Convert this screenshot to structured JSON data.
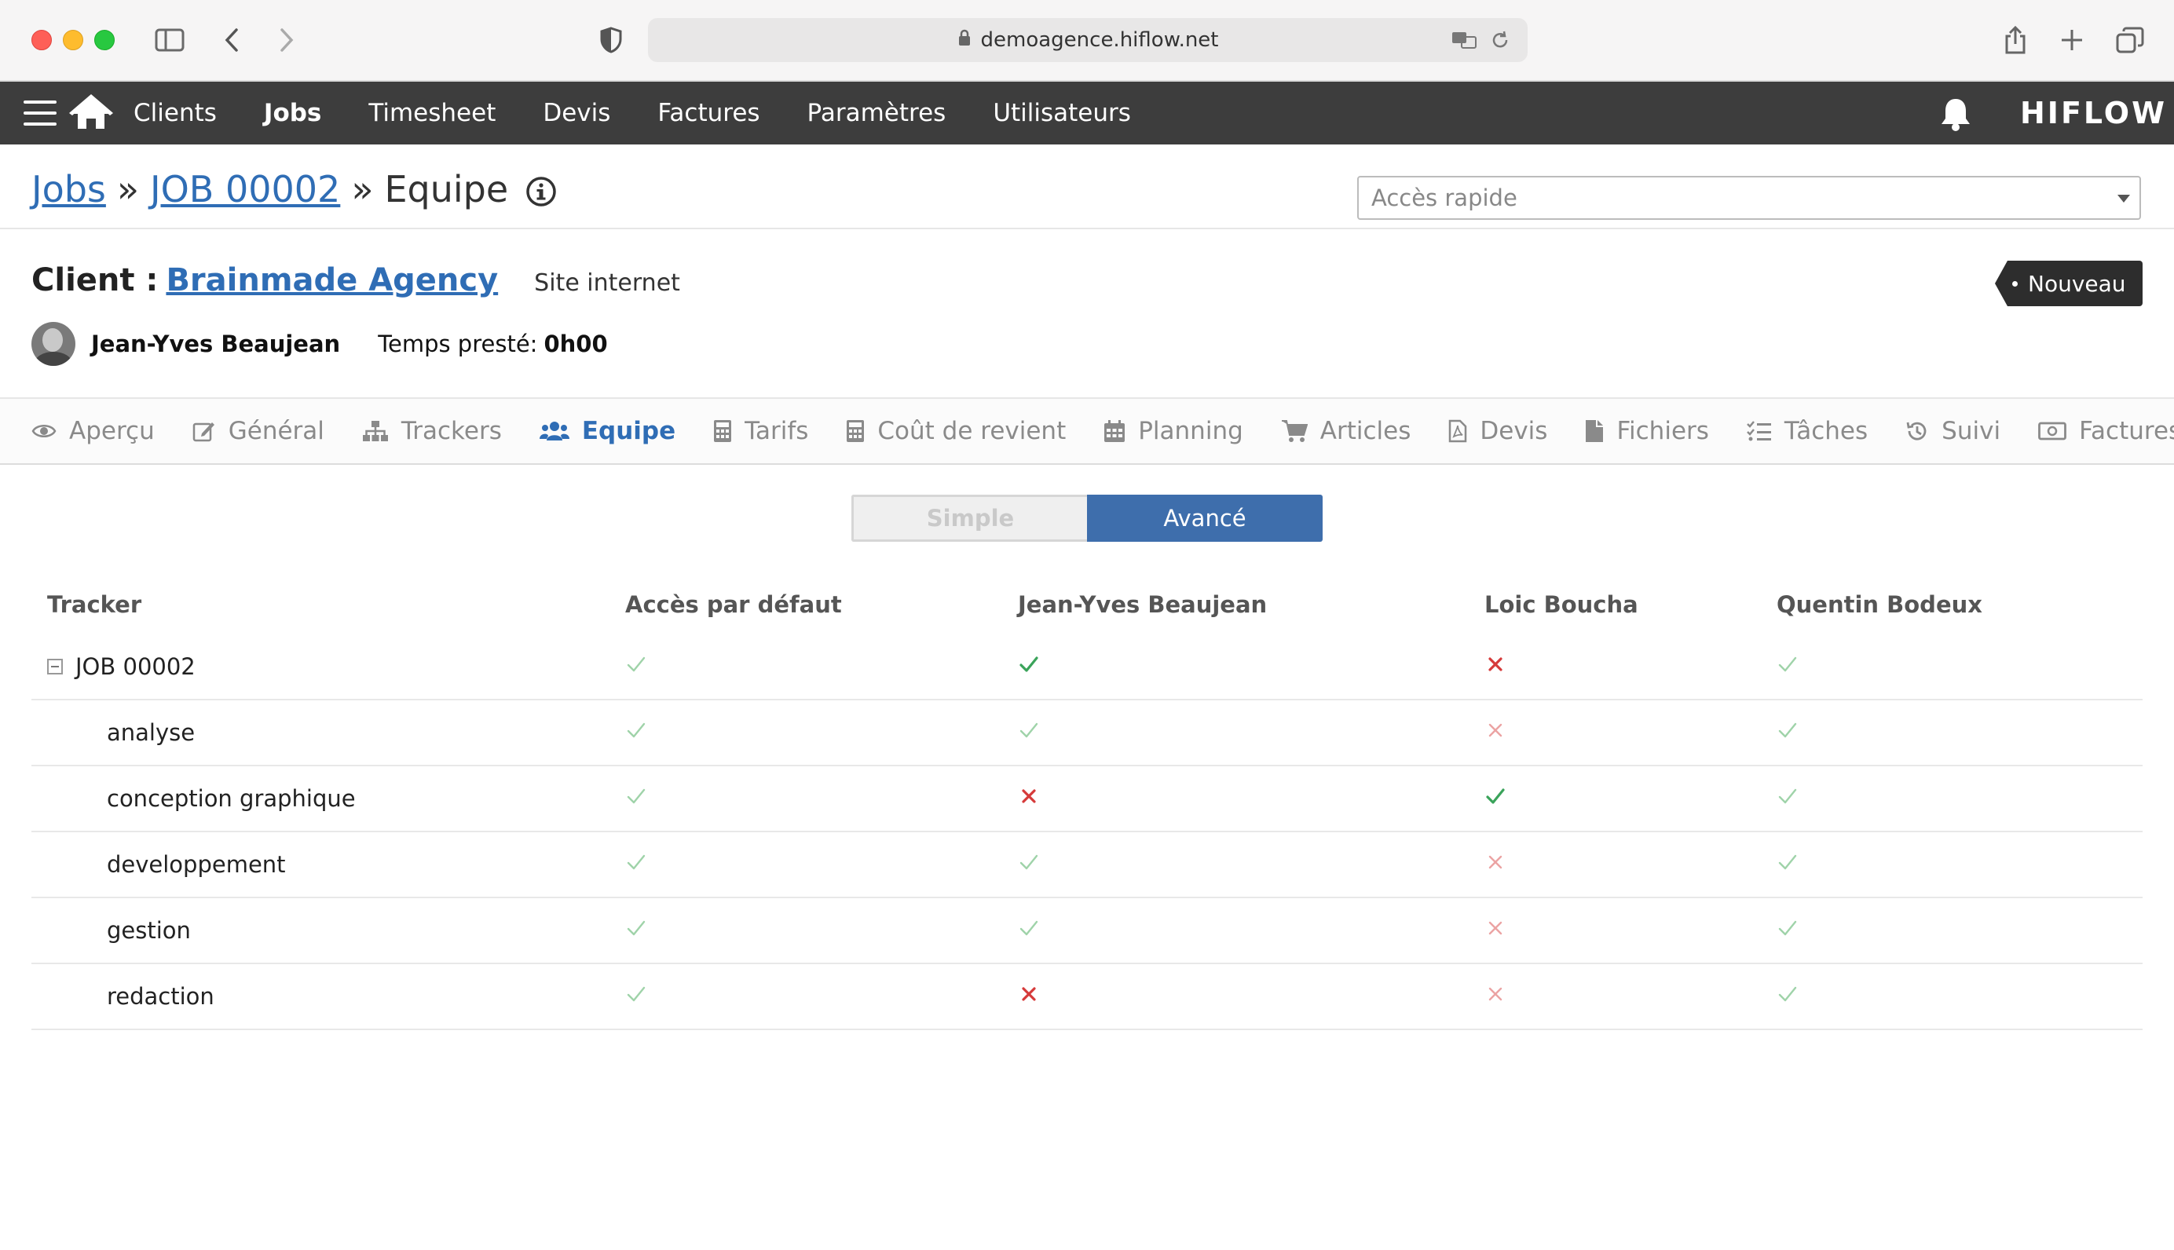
{
  "browser": {
    "url": "demoagence.hiflow.net"
  },
  "nav": {
    "items": [
      "Clients",
      "Jobs",
      "Timesheet",
      "Devis",
      "Factures",
      "Paramètres",
      "Utilisateurs"
    ],
    "active": "Jobs",
    "logo": "HIFLOW"
  },
  "breadcrumb": {
    "root": "Jobs",
    "job": "JOB 00002",
    "sep": "»",
    "current": "Equipe"
  },
  "quick_access": {
    "placeholder": "Accès rapide"
  },
  "client": {
    "label": "Client :",
    "name": "Brainmade Agency",
    "project": "Site internet",
    "status": "Nouveau",
    "user": "Jean-Yves Beaujean",
    "time_label": "Temps presté:",
    "time_value": "0h00"
  },
  "tabs": [
    {
      "label": "Aperçu",
      "icon": "eye-icon"
    },
    {
      "label": "Général",
      "icon": "edit-icon"
    },
    {
      "label": "Trackers",
      "icon": "sitemap-icon"
    },
    {
      "label": "Equipe",
      "icon": "users-icon",
      "active": true
    },
    {
      "label": "Tarifs",
      "icon": "calculator-icon"
    },
    {
      "label": "Coût de revient",
      "icon": "calculator-icon"
    },
    {
      "label": "Planning",
      "icon": "calendar-icon"
    },
    {
      "label": "Articles",
      "icon": "cart-icon"
    },
    {
      "label": "Devis",
      "icon": "pdf-file-icon"
    },
    {
      "label": "Fichiers",
      "icon": "file-icon"
    },
    {
      "label": "Tâches",
      "icon": "tasks-icon"
    },
    {
      "label": "Suivi",
      "icon": "history-icon"
    },
    {
      "label": "Factures",
      "icon": "money-icon"
    }
  ],
  "toggle": {
    "simple": "Simple",
    "advanced": "Avancé",
    "selected": "Avancé"
  },
  "table": {
    "headers": [
      "Tracker",
      "Accès par défaut",
      "Jean-Yves Beaujean",
      "Loic Boucha",
      "Quentin Bodeux"
    ],
    "rows": [
      {
        "name": "JOB 00002",
        "parent": true,
        "access": [
          "yes",
          "yes-strong",
          "no-strong",
          "yes"
        ]
      },
      {
        "name": "analyse",
        "access": [
          "yes",
          "yes",
          "no",
          "yes"
        ]
      },
      {
        "name": "conception graphique",
        "access": [
          "yes",
          "no-strong",
          "yes-strong",
          "yes"
        ]
      },
      {
        "name": "developpement",
        "access": [
          "yes",
          "yes",
          "no",
          "yes"
        ]
      },
      {
        "name": "gestion",
        "access": [
          "yes",
          "yes",
          "no",
          "yes"
        ]
      },
      {
        "name": "redaction",
        "access": [
          "yes",
          "no-strong",
          "no",
          "yes"
        ]
      }
    ]
  },
  "colors": {
    "nav_bg": "#3d3d3d",
    "link": "#2f6db5",
    "toggle_active": "#3e6eac",
    "yes": "#5cb85c",
    "no": "#d9534f"
  }
}
